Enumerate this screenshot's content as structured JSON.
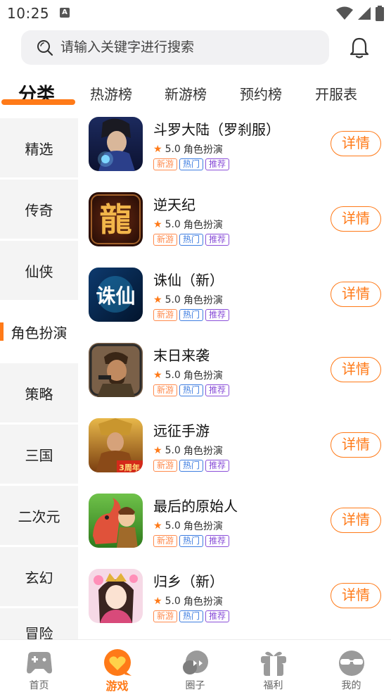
{
  "status_bar": {
    "time": "10:25",
    "notification_glyph": "A"
  },
  "search": {
    "placeholder": "请输入关键字进行搜索"
  },
  "tabs": [
    {
      "label": "分类",
      "active": true
    },
    {
      "label": "热游榜"
    },
    {
      "label": "新游榜"
    },
    {
      "label": "预约榜"
    },
    {
      "label": "开服表"
    }
  ],
  "sidebar": {
    "items": [
      {
        "label": "精选"
      },
      {
        "label": "传奇"
      },
      {
        "label": "仙侠"
      },
      {
        "label": "角色扮演",
        "active": true
      },
      {
        "label": "策略"
      },
      {
        "label": "三国"
      },
      {
        "label": "二次元"
      },
      {
        "label": "玄幻"
      },
      {
        "label": "冒险"
      }
    ]
  },
  "games": [
    {
      "name": "斗罗大陆（罗刹服）",
      "rating": "5.0",
      "genre": "角色扮演",
      "tags": [
        "新游",
        "热门",
        "推荐"
      ],
      "action": "详情"
    },
    {
      "name": "逆天纪",
      "rating": "5.0",
      "genre": "角色扮演",
      "tags": [
        "新游",
        "热门",
        "推荐"
      ],
      "action": "详情"
    },
    {
      "name": "诛仙（新）",
      "rating": "5.0",
      "genre": "角色扮演",
      "tags": [
        "新游",
        "热门",
        "推荐"
      ],
      "action": "详情"
    },
    {
      "name": "末日来袭",
      "rating": "5.0",
      "genre": "角色扮演",
      "tags": [
        "新游",
        "热门",
        "推荐"
      ],
      "action": "详情"
    },
    {
      "name": "远征手游",
      "rating": "5.0",
      "genre": "角色扮演",
      "tags": [
        "新游",
        "热门",
        "推荐"
      ],
      "action": "详情"
    },
    {
      "name": "最后的原始人",
      "rating": "5.0",
      "genre": "角色扮演",
      "tags": [
        "新游",
        "热门",
        "推荐"
      ],
      "action": "详情"
    },
    {
      "name": "归乡（新）",
      "rating": "5.0",
      "genre": "角色扮演",
      "tags": [
        "新游",
        "热门",
        "推荐"
      ],
      "action": "详情"
    }
  ],
  "game_icon_texts": {
    "nitianji": "龍",
    "zhuxian": "诛仙",
    "yuanzheng": "3周年"
  },
  "bottom_nav": [
    {
      "label": "首页",
      "icon": "gamepad-icon"
    },
    {
      "label": "游戏",
      "icon": "heart-chat-icon",
      "active": true
    },
    {
      "label": "圈子",
      "icon": "chat-bubbles-icon"
    },
    {
      "label": "福利",
      "icon": "gift-icon"
    },
    {
      "label": "我的",
      "icon": "sunglasses-face-icon"
    }
  ],
  "colors": {
    "accent": "#ff7a18",
    "tag_new": "#ff8a4c",
    "tag_hot": "#3e7de0",
    "tag_rec": "#8a4fd8"
  }
}
